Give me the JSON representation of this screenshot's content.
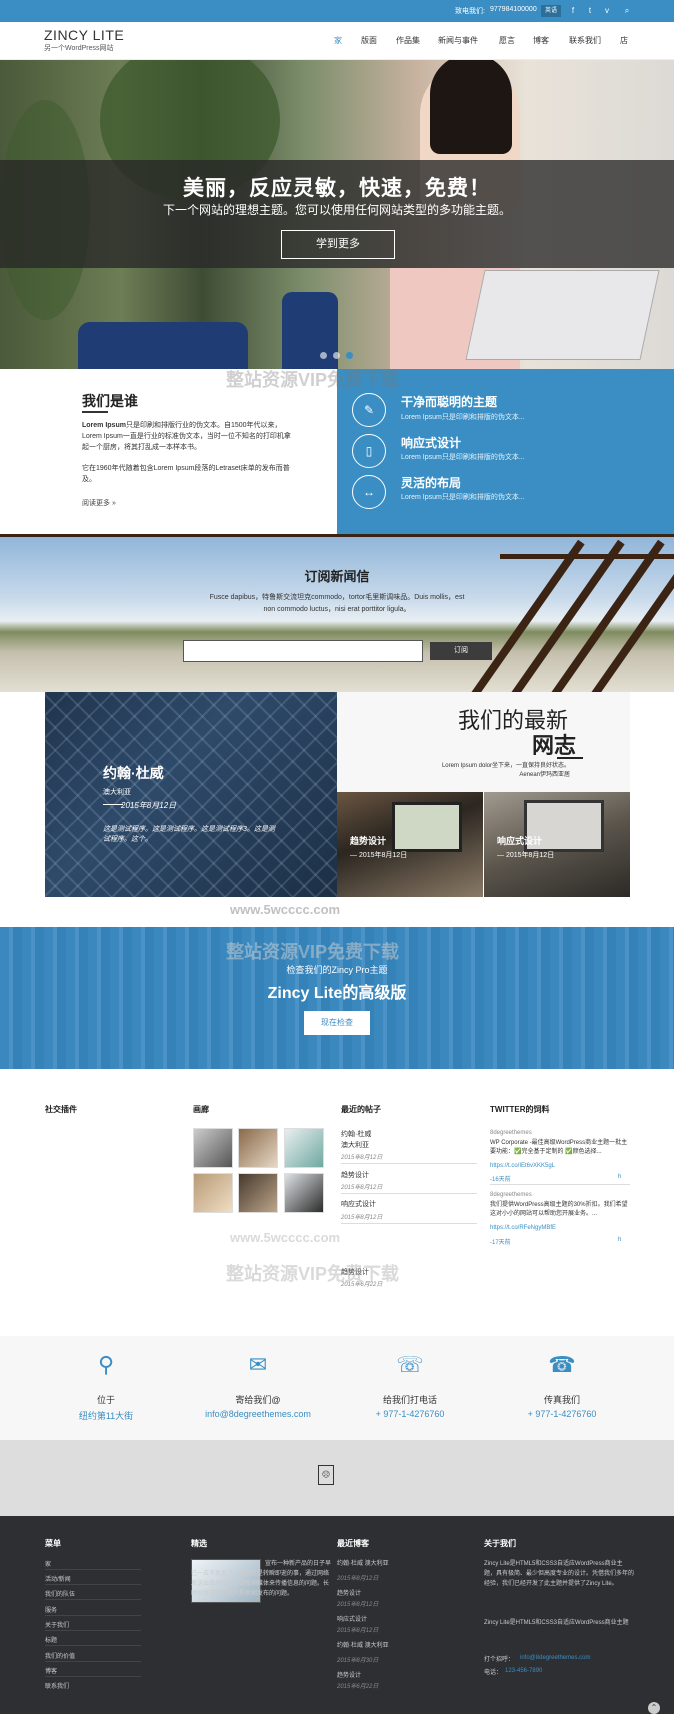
{
  "topbar": {
    "contact_label": "致电我们:",
    "phone": "977984100000",
    "lang": "英语"
  },
  "header": {
    "logo_title": "ZINCY LITE",
    "logo_sub": "另一个WordPress网站",
    "nav": [
      "家",
      "版面",
      "作品集",
      "新闻与事件",
      "愿言",
      "博客",
      "联系我们",
      "店"
    ]
  },
  "hero": {
    "title": "美丽，反应灵敏，快速，免费！",
    "subtitle": "下一个网站的理想主题。您可以使用任何网站类型的多功能主题。",
    "button": "学到更多",
    "slides": 3,
    "active_slide": 2
  },
  "about": {
    "title": "我们是谁",
    "p1_bold": "Lorem Ipsum",
    "p1": "只是印刷和排版行业的伪文本。自1500年代以来，Lorem Ipsum一直是行业的标准伪文本，当时一位不知名的打印机拿起一个厨房，将其打乱成一本样本书。",
    "p2": "它在1960年代随着包含Lorem Ipsum段落的Letraset床单的发布而普及。",
    "more": "阅读更多 »"
  },
  "features": [
    {
      "icon": "brush-icon",
      "title": "干净而聪明的主题",
      "desc": "Lorem Ipsum只是印刷和排版的伪文本..."
    },
    {
      "icon": "mobile-icon",
      "title": "响应式设计",
      "desc": "Lorem Ipsum只是印刷和排版的伪文本..."
    },
    {
      "icon": "arrows-icon",
      "title": "灵活的布局",
      "desc": "Lorem Ipsum只是印刷和排版的伪文本..."
    }
  ],
  "newsletter": {
    "title": "订阅新闻信",
    "text": "Fusce dapibus，特鲁斯交流坦克commodo，tortor毛里斯调味品。Duis mollis，est non commodo luctus，nisi erat porttitor ligula。",
    "button": "订阅"
  },
  "blog": {
    "featured": {
      "title": "约翰·杜威",
      "category": "澳大利亚",
      "date": "2015年8月12日",
      "excerpt": "这是测试程序。这是测试程序。这是测试程序3。这是测试程序。这个。"
    },
    "head_1": "我们的最新",
    "head_2": "网志",
    "head_sub_1": "Lorem Ipsum dolor坐下来，一直保持良好状态。",
    "head_sub_2": "Aenean伊玛西亚居",
    "posts": [
      {
        "title": "趋势设计",
        "date": "2015年8月12日"
      },
      {
        "title": "响应式设计",
        "date": "2015年8月12日"
      }
    ]
  },
  "promo": {
    "subtitle": "检查我们的Zincy Pro主题",
    "title": "Zincy Lite的高级版",
    "button": "现在检查"
  },
  "watermarks": [
    "整站资源VIP免费下载",
    "www.5wcccc.com"
  ],
  "widgets": {
    "social": "社交插件",
    "gallery": "画廊",
    "recent": "最近的帖子",
    "twitter": "TWITTER的饲料",
    "recent_posts": [
      {
        "title": "约翰·杜威",
        "sub": "澳大利亚",
        "date": "2015年8月12日"
      },
      {
        "title": "趋势设计",
        "sub": "",
        "date": "2015年8月12日"
      },
      {
        "title": "响应式设计",
        "sub": "",
        "date": "2015年8月12日"
      },
      {
        "title": "趋势设计",
        "sub": "",
        "date": "2015年6月22日"
      }
    ],
    "tweets": [
      {
        "user": "8degreethemes",
        "text": "WP Corporate -最佳高级WordPress商业主题一批主要功能：✅完全基于定制的 ✅颜色选择...",
        "link": "https://t.co/IEt6vXKK5gL",
        "time": "-16天前",
        "reply": "h"
      },
      {
        "user": "8degreethemes",
        "text": "我们提供WordPress高级主题的30%折扣。我们希望这对小小的网站可以帮助您开展业务。...",
        "link": "https://t.co/RFeNgyMBfE",
        "time": "-17天前",
        "reply": "h"
      }
    ]
  },
  "contact": [
    {
      "icon": "map-pin-icon",
      "label": "位于",
      "value": "纽约第11大街"
    },
    {
      "icon": "envelope-icon",
      "label": "寄给我们@",
      "value": "info@8degreethemes.com"
    },
    {
      "icon": "phone-icon",
      "label": "给我们打电话",
      "value": "+ 977-1-4276760"
    },
    {
      "icon": "fax-icon",
      "label": "传真我们",
      "value": "+ 977-1-4276760"
    }
  ],
  "footer": {
    "menu_title": "菜单",
    "featured_title": "精选",
    "recent_title": "最近博客",
    "about_title": "关于我们",
    "menu": [
      "家",
      "活动/新闻",
      "我们的队伍",
      "服务",
      "关于我们",
      "标题",
      "我们的价值",
      "博客",
      "联系我们"
    ],
    "featured_text": "宣布一种新产品的日子早已一去不复返了。这仅仅是转瞬即逝的事，通过网络发送出去并给出主要新闻媒体来传播信息的问题。长时间发布新产品只是新闻发布的问题。",
    "posts": [
      {
        "title": "约翰·杜威 澳大利亚",
        "date": "2015年8月12日"
      },
      {
        "title": "趋势设计",
        "date": "2015年8月12日"
      },
      {
        "title": "响应式设计",
        "date": "2015年8月12日"
      },
      {
        "title": "约翰·杜威 澳大利亚",
        "date": "2015年8月30日"
      },
      {
        "title": "趋势设计",
        "date": "2015年6月22日"
      }
    ],
    "about_p1": "Zincy Lite是HTML5和CSS3自适应WordPress商业主题，具有极简、最少但高度专业的设计。凭借我们多年的经验，我们已经开发了此主题并提供了Zincy Lite。",
    "about_p2": "Zincy Lite是HTML5和CSS3自适应WordPress商业主题",
    "email_label": "打个招呼：",
    "email": "info@8degreethemes.com",
    "phone_label": "电话：",
    "phone": "123-456-7890"
  },
  "colors": {
    "accent": "#3a8ec3",
    "dark": "#2d2f33"
  }
}
